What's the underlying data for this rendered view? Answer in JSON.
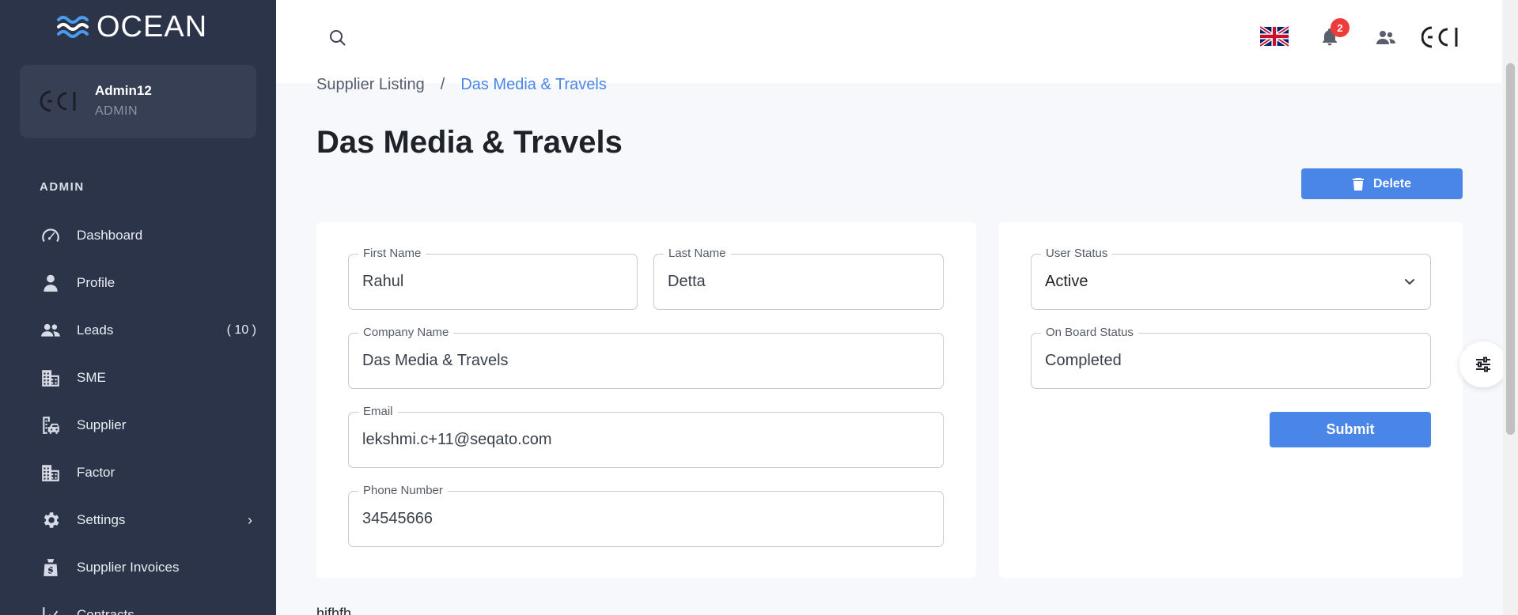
{
  "app": {
    "logo_text": "OCEAN"
  },
  "user": {
    "name": "Admin12",
    "role": "ADMIN"
  },
  "sidebar": {
    "section_label": "ADMIN",
    "items": [
      {
        "label": "Dashboard",
        "icon": "dashboard-icon"
      },
      {
        "label": "Profile",
        "icon": "user-icon"
      },
      {
        "label": "Leads",
        "icon": "people-icon",
        "count": "( 10 )"
      },
      {
        "label": "SME",
        "icon": "building-icon"
      },
      {
        "label": "Supplier",
        "icon": "supplier-icon"
      },
      {
        "label": "Factor",
        "icon": "building-icon"
      },
      {
        "label": "Settings",
        "icon": "gear-icon",
        "chevron": "›"
      },
      {
        "label": "Supplier Invoices",
        "icon": "invoice-bag-icon"
      },
      {
        "label": "Contracts",
        "icon": "chart-line-icon"
      }
    ]
  },
  "topbar": {
    "notification_count": "2"
  },
  "breadcrumb": {
    "parent": "Supplier Listing",
    "separator": "/",
    "current": "Das Media & Travels"
  },
  "page": {
    "title": "Das Media & Travels",
    "delete_label": "Delete"
  },
  "form": {
    "first_name": {
      "label": "First Name",
      "value": "Rahul"
    },
    "last_name": {
      "label": "Last Name",
      "value": "Detta"
    },
    "company_name": {
      "label": "Company Name",
      "value": "Das Media & Travels"
    },
    "email": {
      "label": "Email",
      "value": "lekshmi.c+11@seqato.com"
    },
    "phone": {
      "label": "Phone Number",
      "value": "34545666"
    }
  },
  "status_panel": {
    "user_status": {
      "label": "User Status",
      "value": "Active"
    },
    "onboard_status": {
      "label": "On Board Status",
      "value": "Completed"
    },
    "submit_label": "Submit"
  },
  "below_text": "hjfhfh",
  "colors": {
    "sidebar_bg": "#2b3448",
    "accent": "#4a86e8",
    "badge": "#f03b3b"
  }
}
